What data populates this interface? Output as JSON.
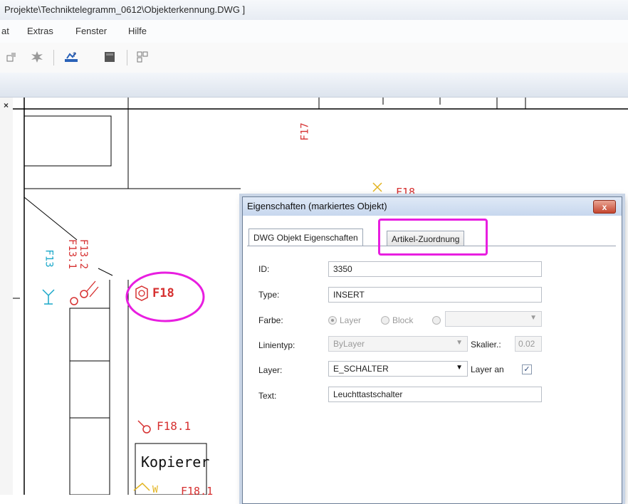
{
  "window": {
    "title": "Projekte\\Techniktelegramm_0612\\Objekterkennung.DWG ]"
  },
  "menu": {
    "items": [
      "at",
      "Extras",
      "Fenster",
      "Hilfe"
    ]
  },
  "toolbar": {
    "icons": [
      "snap-icon",
      "explode-icon",
      "zoom-icon",
      "layer-icon",
      "grid-icon"
    ]
  },
  "drawing": {
    "labels": {
      "f17": "F17",
      "f18_top": "F18",
      "f13": "F13",
      "f13_1": "F13.1",
      "f13_2": "F13.2",
      "f18_main": "F18",
      "f18_1": "F18.1",
      "kopierer": "Kopierer",
      "f18_1_bottom": "F18.1",
      "bottom_w": "W"
    }
  },
  "dialog": {
    "title": "Eigenschaften (markiertes Objekt)",
    "close_label": "x",
    "tabs": [
      "DWG Objekt Eigenschaften",
      "Artikel-Zuordnung"
    ],
    "fields": {
      "id_label": "ID:",
      "id_value": "3350",
      "type_label": "Type:",
      "type_value": "INSERT",
      "farbe_label": "Farbe:",
      "farbe_layer": "Layer",
      "farbe_block": "Block",
      "linientyp_label": "Linientyp:",
      "linientyp_value": "ByLayer",
      "skalier_label": "Skalier.:",
      "skalier_value": "0.02",
      "layer_label": "Layer:",
      "layer_value": "E_SCHALTER",
      "layer_an_label": "Layer an",
      "layer_an_checked": true,
      "text_label": "Text:",
      "text_value": "Leuchttastschalter"
    }
  },
  "colors": {
    "annotation": "#e81ee0",
    "cad_red": "#d63030",
    "cad_cyan": "#19a7c9",
    "cad_yellow": "#e2b31e"
  }
}
